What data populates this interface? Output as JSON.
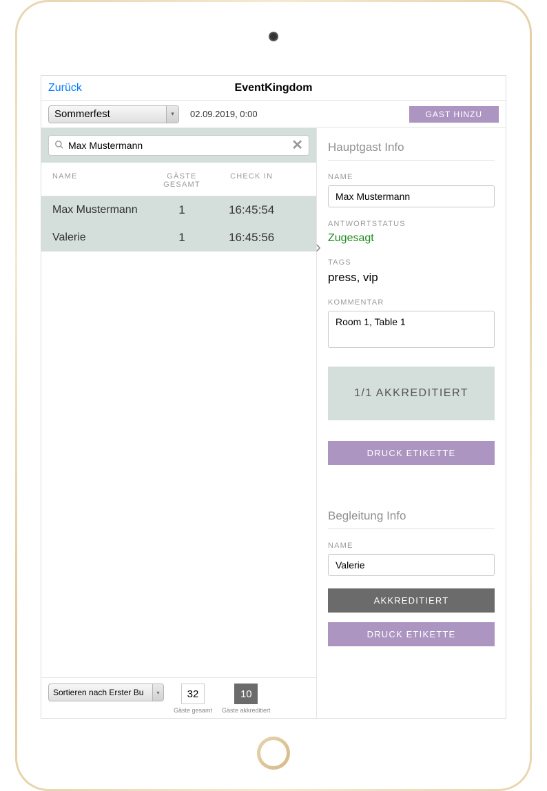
{
  "nav": {
    "back": "Zurück",
    "title": "EventKingdom"
  },
  "toolbar": {
    "event": "Sommerfest",
    "date": "02.09.2019, 0:00",
    "add_guest": "GAST HINZU"
  },
  "search": {
    "value": "Max Mustermann"
  },
  "table": {
    "headers": {
      "name": "NAME",
      "guests": "GÄSTE GESAMT",
      "checkin": "CHECK IN"
    },
    "rows": [
      {
        "name": "Max Mustermann",
        "guests": "1",
        "checkin": "16:45:54"
      },
      {
        "name": "Valerie",
        "guests": "1",
        "checkin": "16:45:56"
      }
    ]
  },
  "bottom": {
    "sort": "Sortieren nach Erster Bu",
    "total": {
      "value": "32",
      "label": "Gäste gesamt"
    },
    "accredited": {
      "value": "10",
      "label": "Gäste akkreditiert"
    }
  },
  "detail": {
    "main_section": "Hauptgast Info",
    "labels": {
      "name": "NAME",
      "status": "ANTWORTSTATUS",
      "tags": "TAGS",
      "comment": "KOMMENTAR"
    },
    "name": "Max Mustermann",
    "status": "Zugesagt",
    "tags": "press, vip",
    "comment": "Room 1, Table 1",
    "accredited": "1/1 AKKREDITIERT",
    "print_label": "DRUCK ETIKETTE",
    "companion_section": "Begleitung Info",
    "companion_name": "Valerie",
    "accredit_btn": "AKKREDITIERT"
  }
}
